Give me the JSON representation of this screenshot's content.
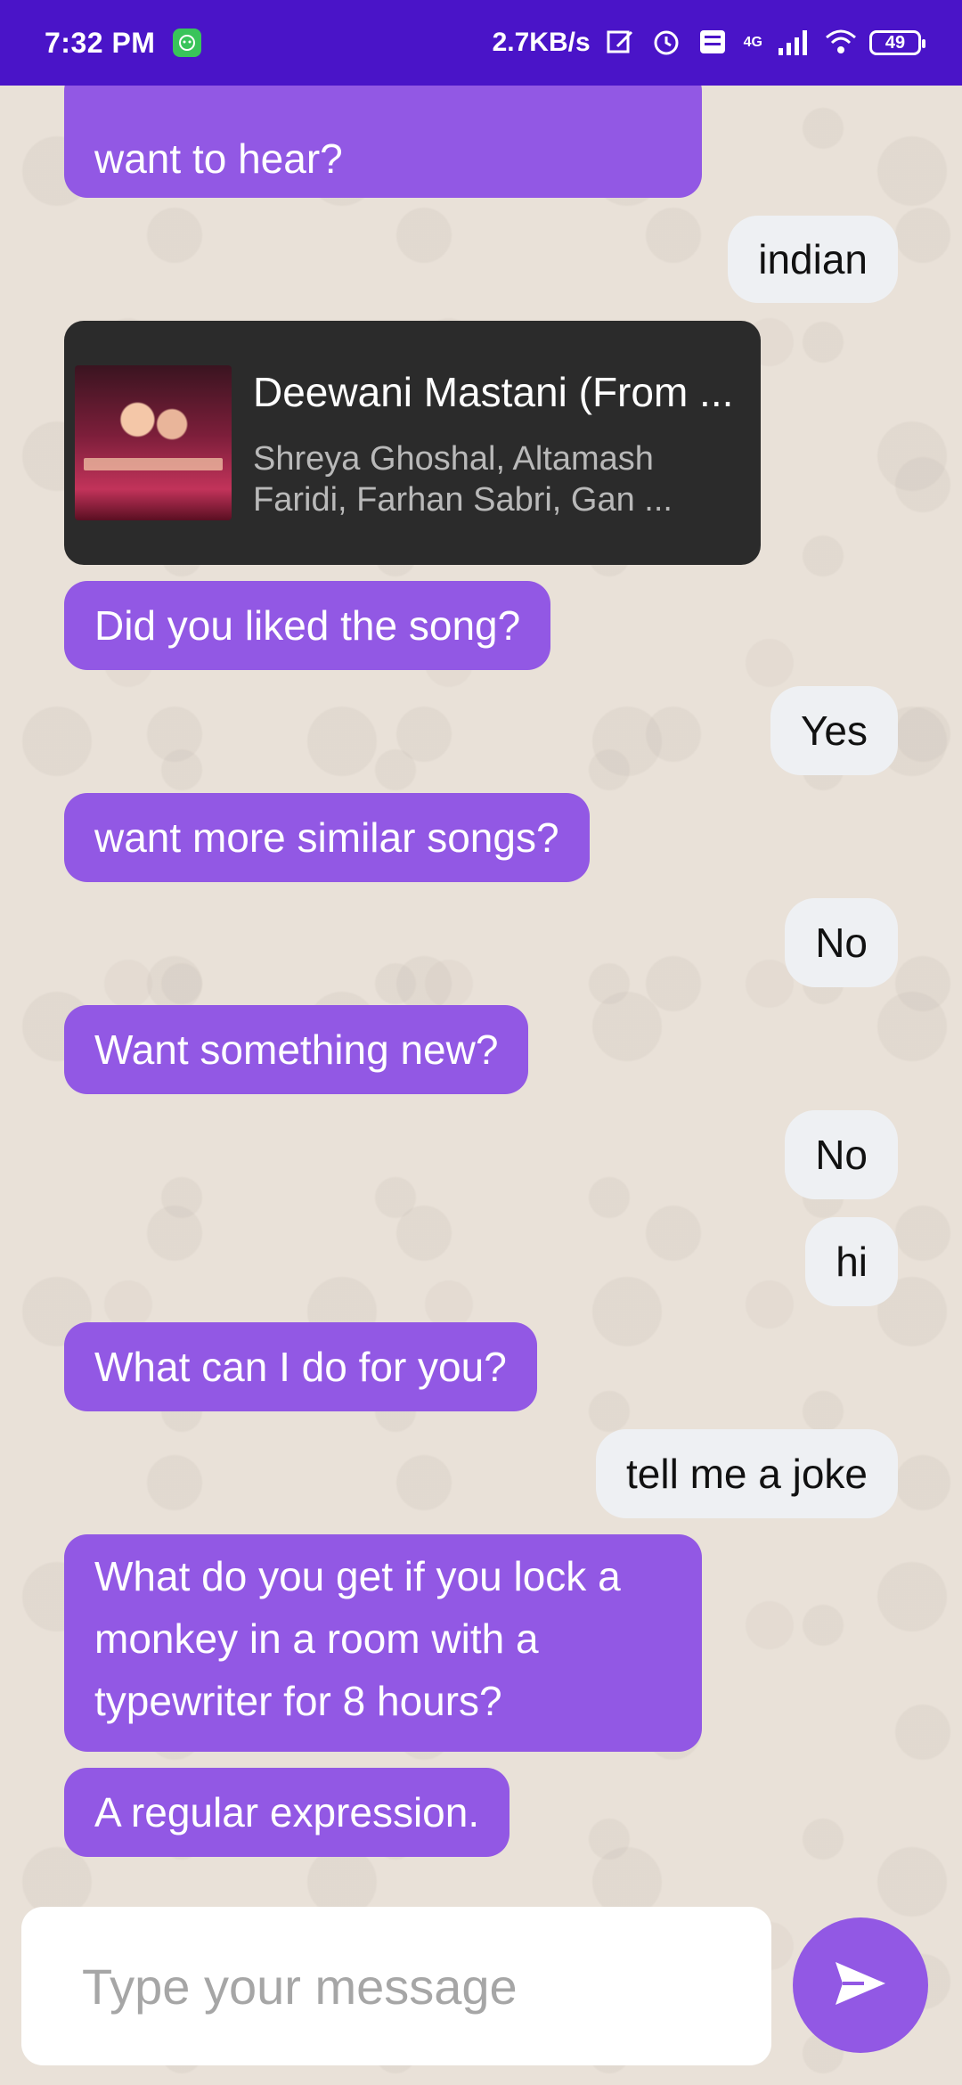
{
  "status_bar": {
    "time": "7:32 PM",
    "net_speed": "2.7KB/s",
    "battery": "49",
    "network_badge": "4G"
  },
  "messages": [
    {
      "from": "bot",
      "text": "want to hear?"
    },
    {
      "from": "user",
      "text": "indian"
    },
    {
      "from": "song",
      "title": "Deewani Mastani (From ...",
      "artist": "Shreya Ghoshal, Altamash Faridi, Farhan Sabri, Gan ..."
    },
    {
      "from": "bot",
      "text": "Did you liked the song?"
    },
    {
      "from": "user",
      "text": "Yes"
    },
    {
      "from": "bot",
      "text": "want more similar songs?"
    },
    {
      "from": "user",
      "text": "No"
    },
    {
      "from": "bot",
      "text": "Want something new?"
    },
    {
      "from": "user",
      "text": "No"
    },
    {
      "from": "user",
      "text": "hi"
    },
    {
      "from": "bot",
      "text": "What can I do for you?"
    },
    {
      "from": "user",
      "text": "tell me a joke"
    },
    {
      "from": "bot",
      "text": "What do you get if you lock a monkey in a room with a typewriter for 8 hours?"
    },
    {
      "from": "bot",
      "text": "A regular expression."
    }
  ],
  "composer": {
    "placeholder": "Type your message"
  },
  "colors": {
    "status_bar": "#4a14c8",
    "bot_bubble": "#9258e4",
    "user_bubble": "#eef0f3",
    "song_card": "#2b2b2b",
    "wallpaper": "#e9e1d8"
  },
  "icons": [
    "app-notification-icon",
    "edit-icon",
    "alarm-icon",
    "volte-icon",
    "signal-icon",
    "wifi-icon",
    "battery-icon",
    "send-icon"
  ]
}
